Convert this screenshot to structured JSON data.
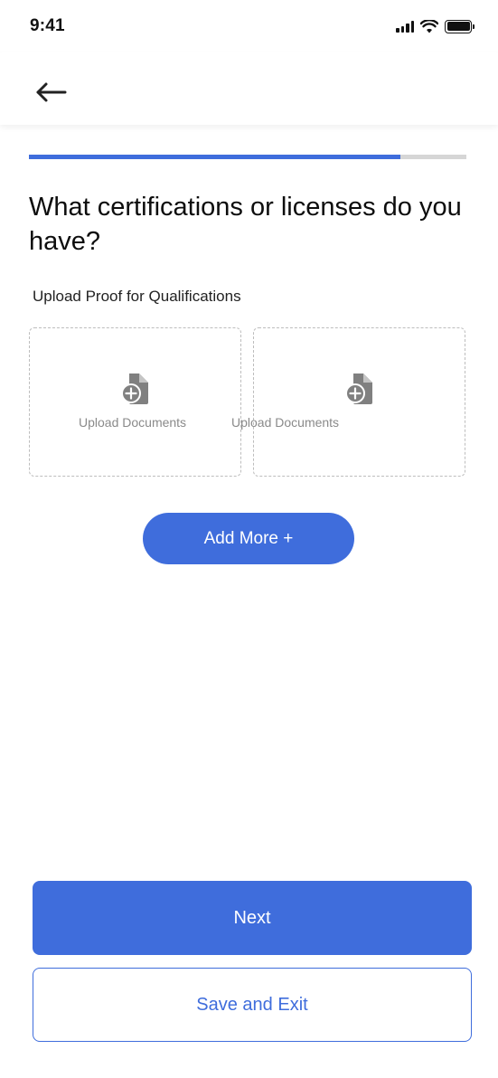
{
  "status_bar": {
    "time": "9:41"
  },
  "header": {
    "back_icon": "arrow-left-icon"
  },
  "progress": {
    "fraction": 0.85,
    "color": "#3f6ddc"
  },
  "question": {
    "title": "What certifications or licenses do you have?"
  },
  "section": {
    "label": "Upload Proof for Qualifications"
  },
  "uploads": [
    {
      "label": "Upload Documents",
      "icon": "document-add-icon"
    },
    {
      "label": "Upload Documents",
      "icon": "document-add-icon"
    }
  ],
  "actions": {
    "add_more": "Add More +",
    "next": "Next",
    "save_exit": "Save and Exit"
  },
  "colors": {
    "accent": "#3f6ddc",
    "icon_gray": "#808080"
  }
}
